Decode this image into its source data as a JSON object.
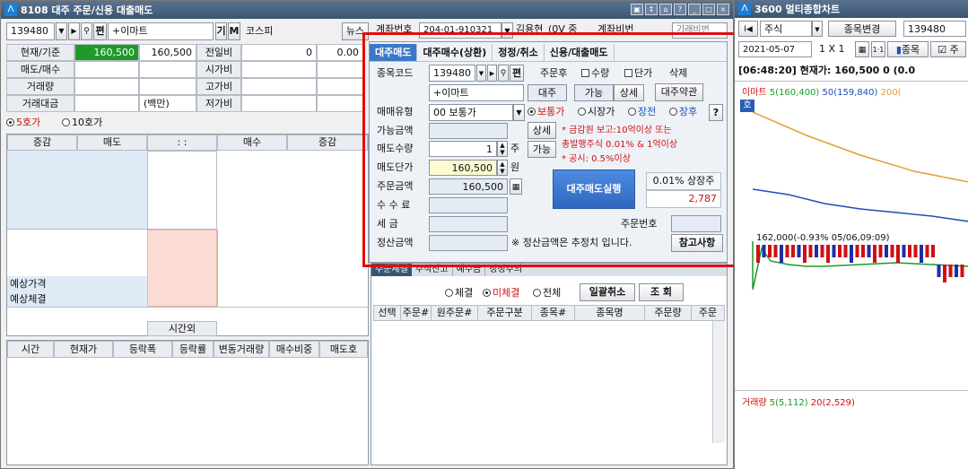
{
  "main_window": {
    "title": "8108 대주 주문/신용 대출매도",
    "code": "139480",
    "ga": "기",
    "m": "M",
    "stock_name": "+이마트",
    "market": "코스피",
    "news": "뉴스",
    "account_label": "계좌번호",
    "account_value": "204-01-910321",
    "acct_owner": "김용현",
    "acct_suffix": "(0V 중",
    "pw_label": "계좌비번",
    "pw_placeholder": "기래비번"
  },
  "quote": {
    "rows": [
      {
        "label": "현재/기준",
        "v1": "160,500",
        "v2": "160,500",
        "label2": "전일비",
        "v3": "0",
        "v4": "0.00"
      },
      {
        "label": "매도/매수",
        "v1": "",
        "v2": "",
        "label2": "시가비",
        "v3": "",
        "v4": ""
      },
      {
        "label": "거래량",
        "v1": "",
        "v2": "",
        "label2": "고가비",
        "v3": "",
        "v4": ""
      },
      {
        "label": "거래대금",
        "v1": "",
        "v2": "(백만)",
        "label2": "저가비",
        "v3": "",
        "v4": ""
      }
    ]
  },
  "hoga": {
    "opt5": "5호가",
    "opt10": "10호가",
    "headers": [
      "증감",
      "매도",
      ": :",
      "매수",
      "증감"
    ],
    "expected_price": "예상가격",
    "expected_trade": "예상체결",
    "after_hours": "시간외"
  },
  "ticks": {
    "headers": [
      "시간",
      "현재가",
      "등락폭",
      "등락률",
      "변동거래량",
      "매수비중",
      "매도호"
    ]
  },
  "dialog": {
    "tabs": [
      "대주매도",
      "대주매수(상환)",
      "정정/취소",
      "신용/대출매도"
    ],
    "code_label": "종목코드",
    "code_value": "139480",
    "pyeon": "편",
    "after_order": "주문후",
    "qty_chk": "수량",
    "price_chk": "단가",
    "delete": "삭제",
    "stock_name": "+이마트",
    "btn_daeju": "대주",
    "btn_possible": "가능",
    "btn_detail": "상세",
    "btn_terms": "대주약관",
    "order_type_label": "매매유형",
    "order_type_value": "00 보통가",
    "r_normal": "보통가",
    "r_market": "시장가",
    "r_before": "장전",
    "r_after": "장후",
    "help": "?",
    "avail_amt_label": "가능금액",
    "detail_btn": "상세",
    "note1": "* 금감원 보고:10억이상 또는",
    "note2": "총발행주식 0.01% & 1억이상",
    "note3": "* 공시: 0.5%이상",
    "sell_qty_label": "매도수량",
    "sell_qty_value": "1",
    "ju": "주",
    "possible_btn": "가능",
    "sell_price_label": "매도단가",
    "sell_price_value": "160,500",
    "won": "원",
    "order_amt_label": "주문금액",
    "order_amt_value": "160,500",
    "execute_btn": "대주매도실행",
    "pct_label": "0.01% 상장주",
    "pct_value": "2,787",
    "fee_label": "수 수 료",
    "tax_label": "세   금",
    "order_no_label": "주문번호",
    "settle_label": "정산금액",
    "settle_note": "※ 정산금액은 추정치 입니다.",
    "ref_btn": "참고사항"
  },
  "orders_panel": {
    "tabs": [
      "주문체결",
      "주식잔고",
      "예수금",
      "정정주의"
    ],
    "r_filled": "체결",
    "r_unfilled": "미체결",
    "r_all": "전체",
    "bulk_cancel": "일괄취소",
    "query": "조 회",
    "headers": [
      "선택",
      "주문#",
      "원주문#",
      "주문구분",
      "종목#",
      "종목명",
      "주문량",
      "주문"
    ]
  },
  "chart_window": {
    "title": "3600 멀티종합차트",
    "type": "주식",
    "change_btn": "종목변경",
    "code": "139480",
    "date": "2021-05-07",
    "scale": "1 X 1",
    "item_btn": "종목",
    "time_bar": "[06:48:20] 현재가: 160,500 0 (0.0",
    "legend_name": "이마트",
    "ma5": "5(160,400)",
    "ma50": "50(159,840)",
    "ma200": "200(",
    "tag": "호",
    "annotation": "162,000(-0.93% 05/06,09:09)",
    "vol_name": "거래량",
    "vol5": "5(5,112)",
    "vol20": "20(2,529)"
  },
  "colors": {
    "accent": "#3b78c8",
    "highlight_green": "#1f9a2a",
    "frame_red": "#e20d0d"
  }
}
